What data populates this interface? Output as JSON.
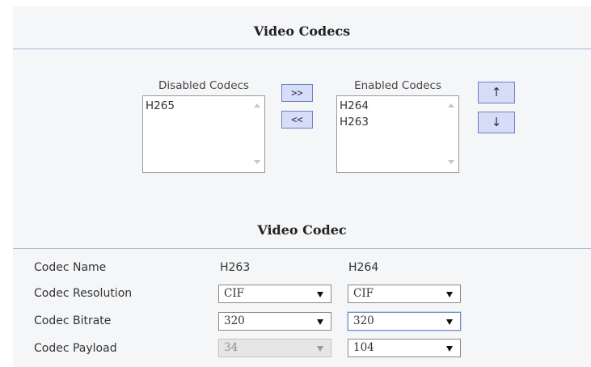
{
  "codecs_section": {
    "title": "Video Codecs",
    "disabled_caption": "Disabled Codecs",
    "enabled_caption": "Enabled Codecs",
    "disabled_items": [
      "H265"
    ],
    "enabled_items": [
      "H264",
      "H263"
    ],
    "move_to_enabled_label": ">>",
    "move_to_disabled_label": "<<",
    "move_up_glyph": "↑",
    "move_down_glyph": "↓"
  },
  "codec_section": {
    "title": "Video Codec",
    "columns": [
      "H263",
      "H264"
    ],
    "rows": [
      {
        "label": "Codec Name"
      },
      {
        "label": "Codec Resolution",
        "h263": "CIF",
        "h264": "CIF"
      },
      {
        "label": "Codec Bitrate",
        "h263": "320",
        "h264": "320"
      },
      {
        "label": "Codec Payload",
        "h263": "34",
        "h264": "104",
        "h263_disabled": true
      }
    ]
  },
  "icons": {
    "listbox_scroll_up": "scroll-up-arrow-icon",
    "listbox_scroll_down": "scroll-down-arrow-icon",
    "select_dropdown": "dropdown-arrow-icon"
  },
  "colors": {
    "panel_background": "#f5f6f8",
    "divider": "#a9b7d6",
    "button_fill": "#d7dcf7",
    "button_border": "#6e7fc3"
  }
}
